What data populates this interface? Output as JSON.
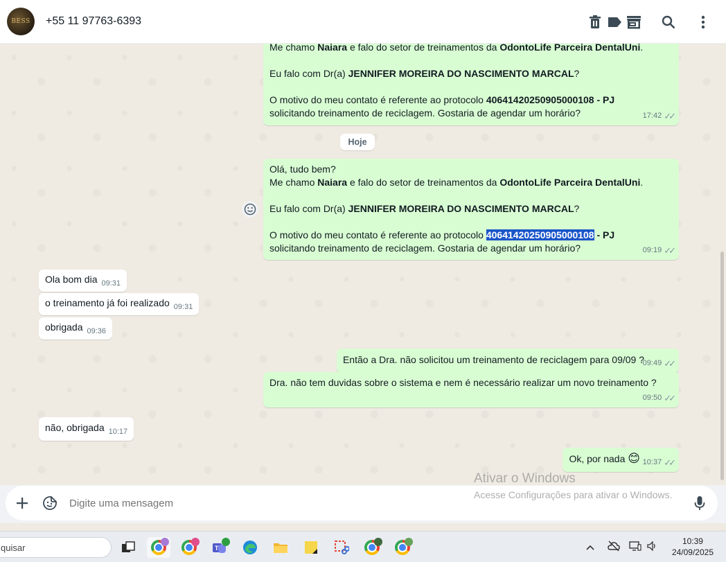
{
  "header": {
    "avatar_text": "BESS",
    "contact": "+55 11 97763-6393",
    "icons": [
      "trash-icon",
      "label-icon",
      "store-icon",
      "search-icon",
      "more-vert-icon"
    ]
  },
  "chat": {
    "msg_top": {
      "line1_a": "Me chamo ",
      "line1_name": "Naiara",
      "line1_b": " e falo do setor de treinamentos da ",
      "line1_company": "OdontoLife Parceira DentalUni",
      "line1_c": ".",
      "line2_a": "Eu falo com Dr(a) ",
      "line2_doctor": "JENNIFER MOREIRA DO NASCIMENTO MARCAL",
      "line2_b": "?",
      "line3_a": "O motivo do meu contato é referente ao protocolo ",
      "line3_protocol": "40641420250905000108 - PJ",
      "line4": "solicitando treinamento de reciclagem. Gostaria de agendar um horário?",
      "time": "17:42"
    },
    "date_divider": "Hoje",
    "msg_main": {
      "greeting": "Olá, tudo bem?",
      "line1_a": "Me chamo ",
      "line1_name": "Naiara",
      "line1_b": " e falo do setor de treinamentos da ",
      "line1_company": "OdontoLife Parceira DentalUni",
      "line1_c": ".",
      "line2_a": "Eu falo com Dr(a) ",
      "line2_doctor": "JENNIFER MOREIRA DO NASCIMENTO MARCAL",
      "line2_b": "?",
      "line3_a": "O motivo do meu contato é referente ao protocolo ",
      "line3_protocol_selected": "40641420250905000108",
      "line3_protocol_rest": " - PJ",
      "line4": "solicitando treinamento de reciclagem. Gostaria de agendar um horário?",
      "time": "09:19"
    },
    "incoming": [
      {
        "text": "Ola bom dia",
        "time": "09:31"
      },
      {
        "text": "o treinamento já foi realizado",
        "time": "09:31"
      },
      {
        "text": "obrigada",
        "time": "09:36"
      }
    ],
    "outgoing": [
      {
        "text": "Então a Dra. não solicitou um treinamento de reciclagem para 09/09 ?",
        "time": "09:49"
      },
      {
        "text": "Dra. não tem duvidas sobre o sistema e nem é necessário realizar um novo treinamento ?",
        "time": "09:50"
      }
    ],
    "incoming_late": {
      "text": "não, obrigada",
      "time": "10:17"
    },
    "last_out": {
      "text": "Ok, por nada",
      "emoji": "😊",
      "time": "10:37"
    }
  },
  "watermark": {
    "title": "Ativar o Windows",
    "subtitle": "Acesse Configurações para ativar o Windows."
  },
  "composer": {
    "placeholder": "Digite uma mensagem"
  },
  "taskbar": {
    "search_text": "quisar",
    "time": "10:39",
    "date": "24/09/2025"
  },
  "colors": {
    "outgoing": "#d9fdd3",
    "incoming": "#ffffff",
    "background": "#efeae2",
    "selection": "#1a56c9"
  }
}
